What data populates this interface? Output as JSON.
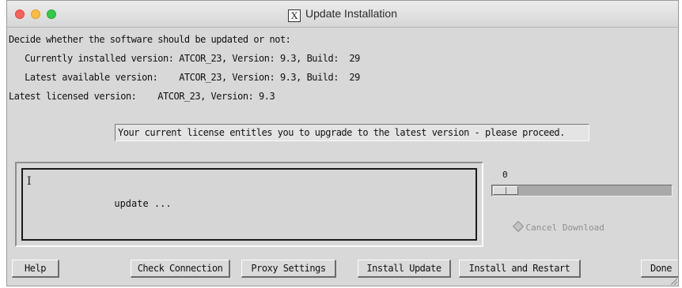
{
  "window": {
    "title": "Update Installation",
    "title_icon": "x11-logo-icon",
    "title_icon_glyph": "X"
  },
  "info": {
    "decide": "Decide whether the software should be updated or not:",
    "installed": "   Currently installed version: ATCOR_23, Version: 9.3, Build:  29",
    "available": "   Latest available version:    ATCOR_23, Version: 9.3, Build:  29",
    "licensed": "Latest licensed version:    ATCOR_23, Version: 9.3"
  },
  "notice": "Your current license entitles you to upgrade to the latest version - please proceed.",
  "log": {
    "text": "update ...",
    "cursor_glyph": "I"
  },
  "progress": {
    "label": "0",
    "value": 0
  },
  "cancel_download": {
    "label": "Cancel Download",
    "enabled": false
  },
  "buttons": {
    "help": "Help",
    "check_connection": "Check Connection",
    "proxy_settings": "Proxy Settings",
    "install_update": "Install Update",
    "install_restart": "Install and Restart",
    "done": "Done"
  },
  "colors": {
    "window_bg": "#d8d8d8",
    "close": "#fc605c",
    "minimize": "#fdbc40",
    "maximize": "#34c84a",
    "disabled_text": "#8f8f8f"
  }
}
